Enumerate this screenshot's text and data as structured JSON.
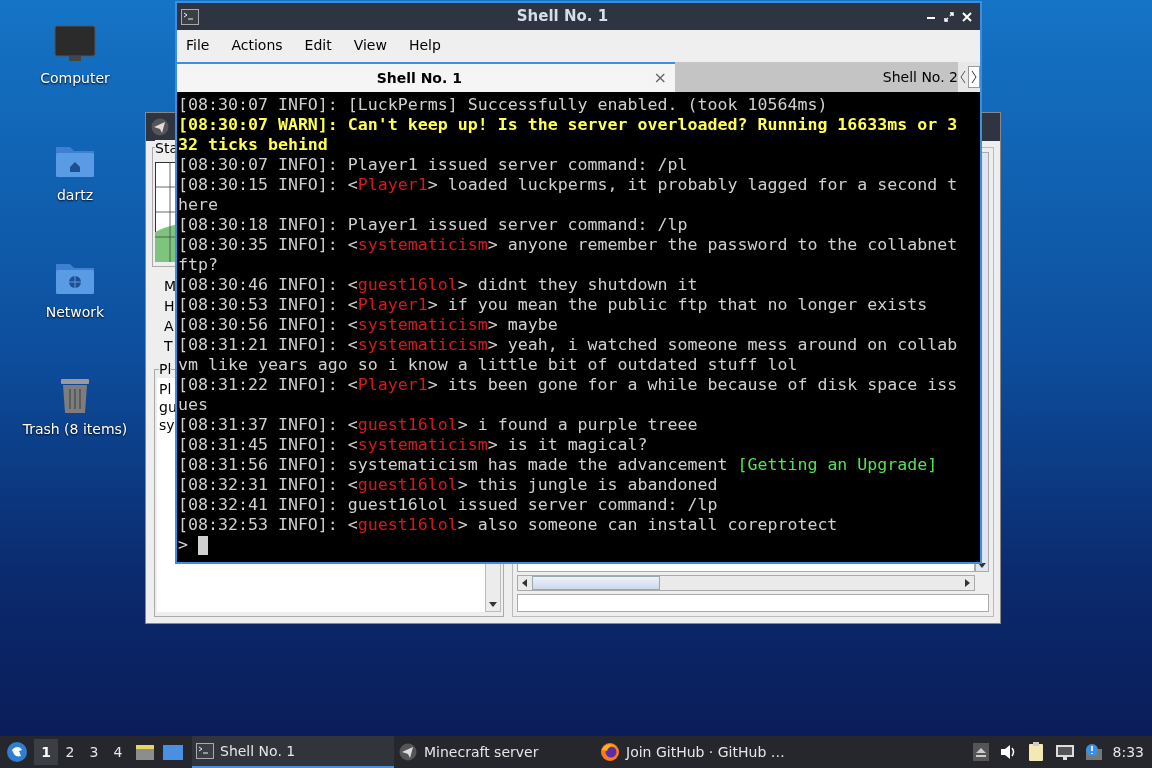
{
  "desktop_icons": [
    {
      "label": "Computer",
      "kind": "computer"
    },
    {
      "label": "dartz",
      "kind": "home"
    },
    {
      "label": "Network",
      "kind": "network"
    },
    {
      "label": "Trash (8 items)",
      "kind": "trash"
    }
  ],
  "server_window": {
    "stats_label": "Sta",
    "stats": [
      "M",
      "H",
      "A",
      "T"
    ],
    "players_label": "Pl",
    "players": [
      "Pl",
      "gu",
      "sy"
    ]
  },
  "terminal": {
    "title": "Shell No. 1",
    "menu": [
      "File",
      "Actions",
      "Edit",
      "View",
      "Help"
    ],
    "tabs": [
      {
        "label": "Shell No. 1",
        "selected": true,
        "close": "×"
      },
      {
        "label": "Shell No. 2",
        "selected": false
      }
    ],
    "lines": [
      {
        "kind": "info",
        "parts": [
          {
            "kind": "plain",
            "text": "[08:30:07 INFO]: [LuckPerms] Successfully enabled. (took 10564ms)"
          }
        ]
      },
      {
        "kind": "warn",
        "parts": [
          {
            "kind": "plain",
            "text": "[08:30:07 WARN]: Can't keep up! Is the server overloaded? Running 16633ms or 332 ticks behind"
          }
        ]
      },
      {
        "kind": "info",
        "parts": [
          {
            "kind": "plain",
            "text": "[08:30:07 INFO]: Player1 issued server command: /pl"
          }
        ]
      },
      {
        "kind": "info",
        "parts": [
          {
            "kind": "plain",
            "text": "[08:30:15 INFO]: <"
          },
          {
            "kind": "player",
            "text": "Player1"
          },
          {
            "kind": "plain",
            "text": "> loaded luckperms, it probably lagged for a second there"
          }
        ]
      },
      {
        "kind": "info",
        "parts": [
          {
            "kind": "plain",
            "text": "[08:30:18 INFO]: Player1 issued server command: /lp"
          }
        ]
      },
      {
        "kind": "info",
        "parts": [
          {
            "kind": "plain",
            "text": "[08:30:35 INFO]: <"
          },
          {
            "kind": "player",
            "text": "systematicism"
          },
          {
            "kind": "plain",
            "text": "> anyone remember the password to the collabnet ftp?"
          }
        ]
      },
      {
        "kind": "info",
        "parts": [
          {
            "kind": "plain",
            "text": "[08:30:46 INFO]: <"
          },
          {
            "kind": "player",
            "text": "guest16lol"
          },
          {
            "kind": "plain",
            "text": "> didnt they shutdown it"
          }
        ]
      },
      {
        "kind": "info",
        "parts": [
          {
            "kind": "plain",
            "text": "[08:30:53 INFO]: <"
          },
          {
            "kind": "player",
            "text": "Player1"
          },
          {
            "kind": "plain",
            "text": "> if you mean the public ftp that no longer exists"
          }
        ]
      },
      {
        "kind": "info",
        "parts": [
          {
            "kind": "plain",
            "text": "[08:30:56 INFO]: <"
          },
          {
            "kind": "player",
            "text": "systematicism"
          },
          {
            "kind": "plain",
            "text": "> maybe"
          }
        ]
      },
      {
        "kind": "info",
        "parts": [
          {
            "kind": "plain",
            "text": "[08:31:21 INFO]: <"
          },
          {
            "kind": "player",
            "text": "systematicism"
          },
          {
            "kind": "plain",
            "text": "> yeah, i watched someone mess around on collabvm like years ago so i know a little bit of outdated stuff lol"
          }
        ]
      },
      {
        "kind": "info",
        "parts": [
          {
            "kind": "plain",
            "text": "[08:31:22 INFO]: <"
          },
          {
            "kind": "player",
            "text": "Player1"
          },
          {
            "kind": "plain",
            "text": "> its been gone for a while because of disk space issues"
          }
        ]
      },
      {
        "kind": "info",
        "parts": [
          {
            "kind": "plain",
            "text": "[08:31:37 INFO]: <"
          },
          {
            "kind": "player",
            "text": "guest16lol"
          },
          {
            "kind": "plain",
            "text": "> i found a purple treee"
          }
        ]
      },
      {
        "kind": "info",
        "parts": [
          {
            "kind": "plain",
            "text": "[08:31:45 INFO]: <"
          },
          {
            "kind": "player",
            "text": "systematicism"
          },
          {
            "kind": "plain",
            "text": "> is it magical?"
          }
        ]
      },
      {
        "kind": "info",
        "parts": [
          {
            "kind": "plain",
            "text": "[08:31:56 INFO]: systematicism has made the advancement "
          },
          {
            "kind": "advancement",
            "text": "[Getting an Upgrade]"
          }
        ]
      },
      {
        "kind": "info",
        "parts": [
          {
            "kind": "plain",
            "text": "[08:32:31 INFO]: <"
          },
          {
            "kind": "player",
            "text": "guest16lol"
          },
          {
            "kind": "plain",
            "text": "> this jungle is abandoned"
          }
        ]
      },
      {
        "kind": "info",
        "parts": [
          {
            "kind": "plain",
            "text": "[08:32:41 INFO]: guest16lol issued server command: /lp"
          }
        ]
      },
      {
        "kind": "info",
        "parts": [
          {
            "kind": "plain",
            "text": "[08:32:53 INFO]: <"
          },
          {
            "kind": "player",
            "text": "guest16lol"
          },
          {
            "kind": "plain",
            "text": "> also someone can install coreprotect"
          }
        ]
      }
    ],
    "prompt": ">"
  },
  "taskbar": {
    "workspaces": [
      {
        "label": "1",
        "selected": true
      },
      {
        "label": "2",
        "selected": false
      },
      {
        "label": "3",
        "selected": false
      },
      {
        "label": "4",
        "selected": false
      }
    ],
    "tasks": [
      {
        "label": "Shell No. 1",
        "kind": "terminal",
        "selected": true
      },
      {
        "label": "Minecraft server",
        "kind": "server",
        "selected": false
      },
      {
        "label": "Join GitHub · GitHub …",
        "kind": "browser",
        "selected": false
      }
    ],
    "clock": "8:33"
  }
}
